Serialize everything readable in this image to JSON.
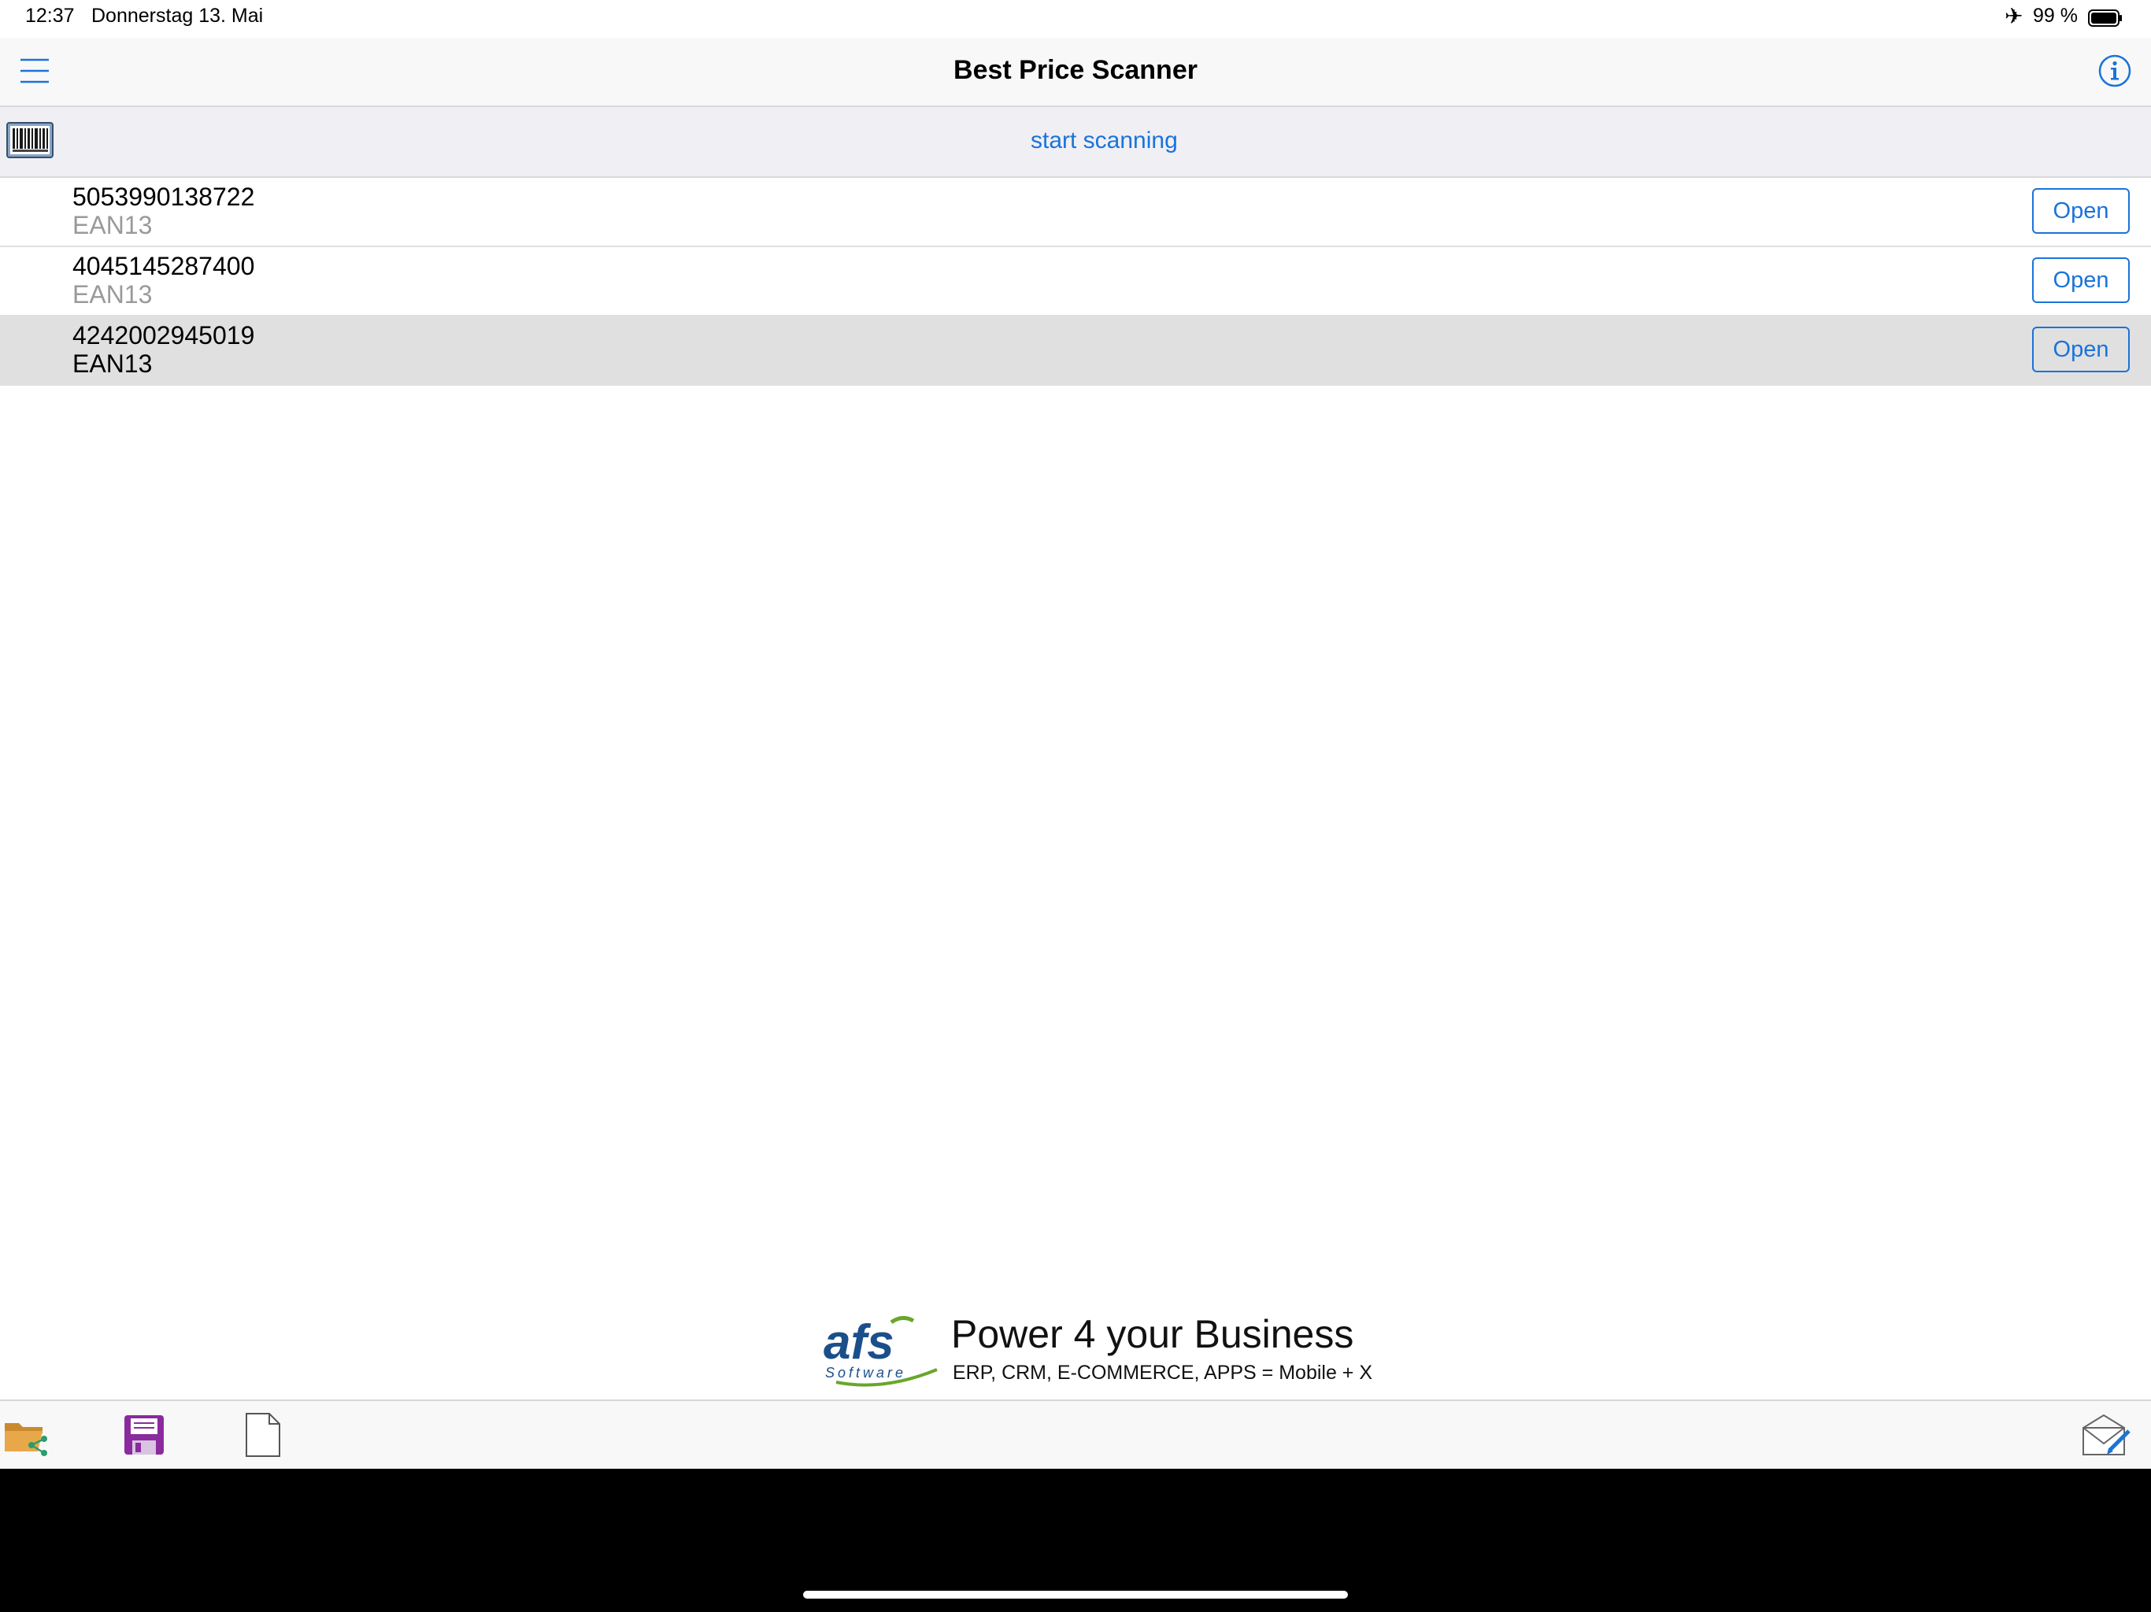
{
  "status_bar": {
    "time": "12:37",
    "date": "Donnerstag 13. Mai",
    "battery": "99 %",
    "airplane_icon": "airplane-icon"
  },
  "nav": {
    "title": "Best Price Scanner",
    "menu_icon": "hamburger-menu-icon",
    "info_icon": "info-icon"
  },
  "scan_bar": {
    "label": "start scanning",
    "icon": "barcode-icon"
  },
  "list": {
    "rows": [
      {
        "code": "5053990138722",
        "type": "EAN13",
        "button": "Open"
      },
      {
        "code": "4045145287400",
        "type": "EAN13",
        "button": "Open"
      },
      {
        "code": "4242002945019",
        "type": "EAN13",
        "button": "Open"
      }
    ]
  },
  "banner": {
    "logo_text": "afs",
    "logo_sub": "Software",
    "headline": "Power 4 your Business",
    "tagline": "ERP, CRM, E-COMMERCE, APPS = Mobile + X"
  },
  "toolbar": {
    "icons": [
      "folder-share-icon",
      "save-icon",
      "new-document-icon",
      "mail-compose-icon"
    ]
  },
  "colors": {
    "accent": "#1a73d9",
    "row_selected": "#e0e0e0",
    "secondary_text": "#9a9a9a"
  }
}
